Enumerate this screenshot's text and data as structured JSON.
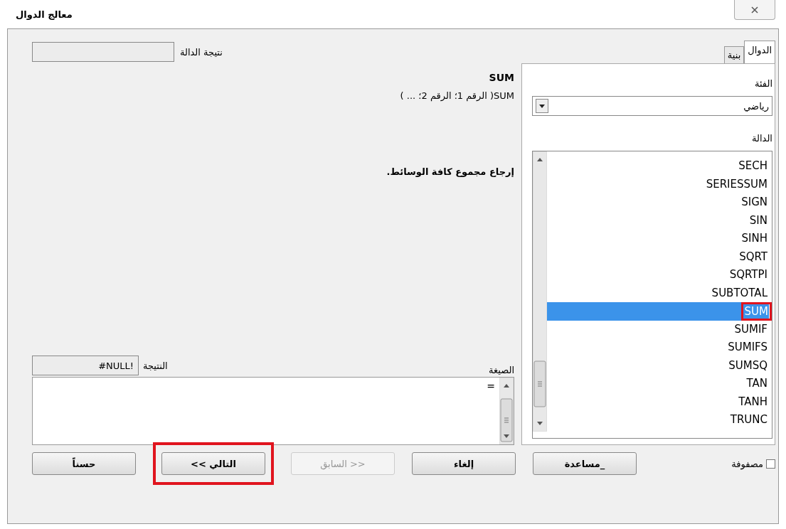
{
  "window": {
    "title": "معالج الدوال"
  },
  "tabs": [
    {
      "label": "الدوال",
      "selected": true
    },
    {
      "label": "بنية",
      "selected": false
    }
  ],
  "category": {
    "label": "الفئة",
    "value": "رياضي"
  },
  "functions": {
    "label": "الدالة",
    "items": [
      {
        "name": "SECH",
        "selected": false,
        "highlighted": false
      },
      {
        "name": "SERIESSUM",
        "selected": false,
        "highlighted": false
      },
      {
        "name": "SIGN",
        "selected": false,
        "highlighted": false
      },
      {
        "name": "SIN",
        "selected": false,
        "highlighted": false
      },
      {
        "name": "SINH",
        "selected": false,
        "highlighted": false
      },
      {
        "name": "SQRT",
        "selected": false,
        "highlighted": false
      },
      {
        "name": "SQRTPI",
        "selected": false,
        "highlighted": false
      },
      {
        "name": "SUBTOTAL",
        "selected": false,
        "highlighted": false
      },
      {
        "name": "SUM",
        "selected": true,
        "highlighted": true
      },
      {
        "name": "SUMIF",
        "selected": false,
        "highlighted": false
      },
      {
        "name": "SUMIFS",
        "selected": false,
        "highlighted": false
      },
      {
        "name": "SUMSQ",
        "selected": false,
        "highlighted": false
      },
      {
        "name": "TAN",
        "selected": false,
        "highlighted": false
      },
      {
        "name": "TANH",
        "selected": false,
        "highlighted": false
      },
      {
        "name": "TRUNC",
        "selected": false,
        "highlighted": false
      }
    ]
  },
  "function_result": {
    "label": "نتيجة الدالة"
  },
  "info": {
    "name": "SUM",
    "syntax": "SUM( الرقم 1؛ الرقم 2؛ ... )",
    "description": "إرجاع مجموع كافة الوسائط."
  },
  "formula": {
    "label": "الصيغة",
    "value": "="
  },
  "result": {
    "label": "النتيجة",
    "value": "#NULL!"
  },
  "array": {
    "label": "مصفوفة",
    "checked": false
  },
  "buttons": [
    {
      "label": "_مساعدة",
      "disabled": false,
      "highlighted": false
    },
    {
      "label": "إلغاء",
      "disabled": false,
      "highlighted": false
    },
    {
      "label": "<< السابق",
      "disabled": true,
      "highlighted": false
    },
    {
      "label": "التالي >>",
      "disabled": false,
      "highlighted": true
    },
    {
      "label": "حسناً",
      "disabled": false,
      "highlighted": false
    }
  ]
}
